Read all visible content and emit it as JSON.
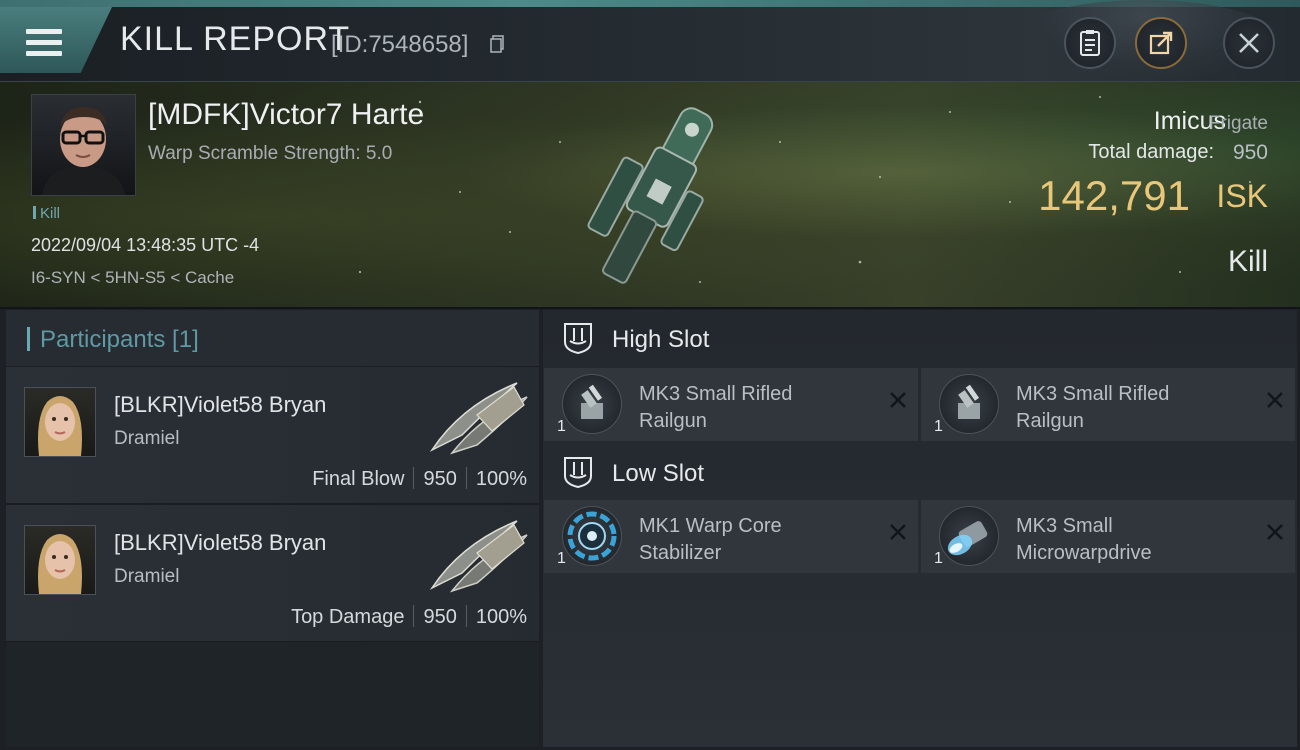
{
  "header": {
    "title": "KILL REPORT",
    "report_id": "[ID:7548658]",
    "icons": [
      "menu-icon",
      "copy-icon",
      "clipboard-icon",
      "share-icon",
      "close-icon"
    ]
  },
  "victim": {
    "name": "[MDFK]Victor7 Harte",
    "warp_scramble": "Warp Scramble Strength: 5.0",
    "tag": "Kill",
    "datetime": "2022/09/04 13:48:35 UTC -4",
    "location": "I6-SYN < 5HN-S5 < Cache",
    "ship_name": "Imicus",
    "ship_class": "Frigate",
    "total_damage_label": "Total damage:",
    "total_damage_value": "950",
    "isk_value": "142,791",
    "isk_unit": "ISK",
    "result": "Kill"
  },
  "participants": {
    "title": "Participants [1]",
    "rows": [
      {
        "name": "[BLKR]Violet58 Bryan",
        "ship": "Dramiel",
        "role": "Final Blow",
        "damage": "950",
        "percent": "100%"
      },
      {
        "name": "[BLKR]Violet58 Bryan",
        "ship": "Dramiel",
        "role": "Top Damage",
        "damage": "950",
        "percent": "100%"
      }
    ]
  },
  "fitting": {
    "high_slot": {
      "title": "High Slot",
      "modules": [
        {
          "name_line1": "MK3 Small Rifled",
          "name_line2": "Railgun",
          "qty": "1"
        },
        {
          "name_line1": "MK3 Small Rifled",
          "name_line2": "Railgun",
          "qty": "1"
        }
      ]
    },
    "low_slot": {
      "title": "Low Slot",
      "modules": [
        {
          "name_line1": "MK1 Warp Core",
          "name_line2": "Stabilizer",
          "qty": "1"
        },
        {
          "name_line1": "MK3 Small",
          "name_line2": "Microwarpdrive",
          "qty": "1"
        }
      ]
    }
  },
  "colors": {
    "accent_teal": "#4d8a89",
    "isk_gold": "#e8c77a",
    "participants_title": "#5f99a3"
  }
}
